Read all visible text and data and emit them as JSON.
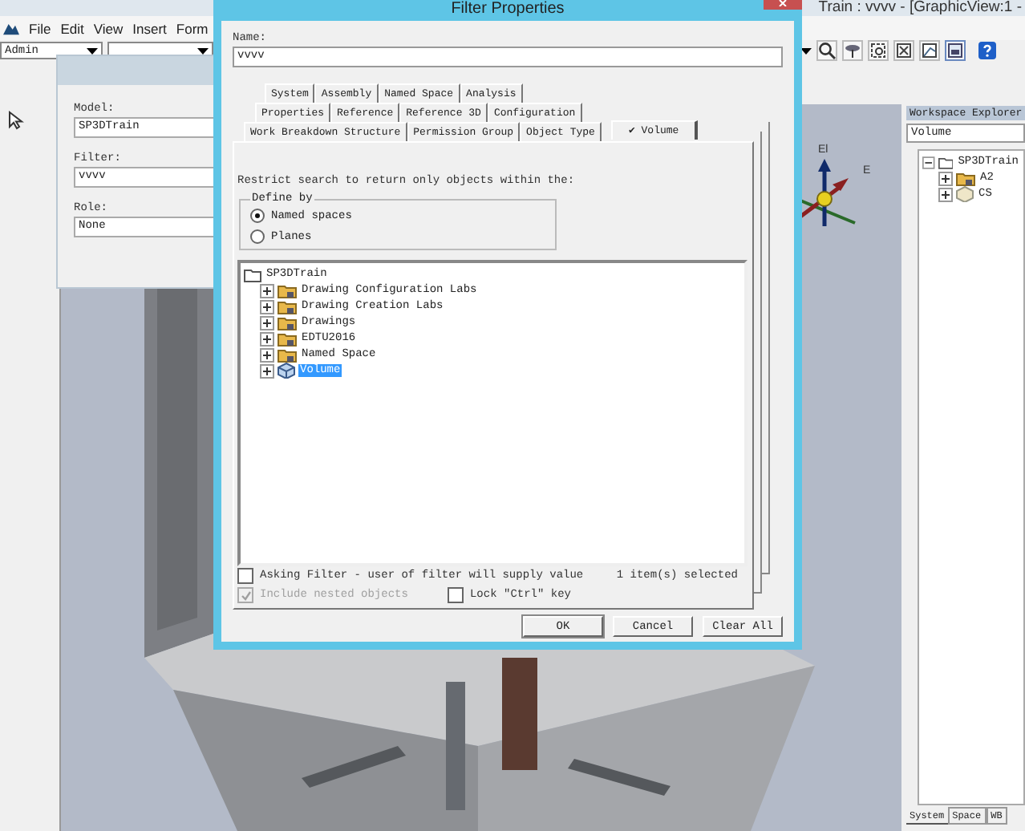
{
  "app": {
    "title": "Train : vvvv - [GraphicView:1 -",
    "menu": [
      "File",
      "Edit",
      "View",
      "Insert",
      "Form"
    ],
    "role_combo": {
      "value": "Admin"
    }
  },
  "viewport": {
    "axis_labels": [
      "El",
      "E"
    ]
  },
  "workspace_explorer": {
    "title": "Workspace Explorer",
    "filter": {
      "value": "Volume"
    },
    "tree": [
      {
        "label": "SP3DTrain",
        "kind": "root",
        "expanded": true,
        "children": [
          {
            "label": "A2",
            "kind": "folder",
            "expanded": false
          },
          {
            "label": "CS",
            "kind": "space",
            "expanded": false
          }
        ]
      }
    ],
    "tabs": [
      {
        "label": "System",
        "selected": true
      },
      {
        "label": "Space",
        "selected": false
      },
      {
        "label": "WB",
        "selected": false
      }
    ]
  },
  "select_dialog": {
    "fields": [
      {
        "label": "Model:",
        "value": "SP3DTrain"
      },
      {
        "label": "Filter:",
        "value": "vvvv"
      },
      {
        "label": "Role:",
        "value": "None"
      }
    ]
  },
  "filter_dialog": {
    "title": "Filter Properties",
    "name": {
      "label": "Name:",
      "value": "vvvv"
    },
    "tab_rows": [
      [
        {
          "label": "System",
          "selected": false
        },
        {
          "label": "Assembly",
          "selected": false
        },
        {
          "label": "Named Space",
          "selected": false
        },
        {
          "label": "Analysis",
          "selected": false
        }
      ],
      [
        {
          "label": "Properties",
          "selected": false
        },
        {
          "label": "Reference",
          "selected": false
        },
        {
          "label": "Reference 3D",
          "selected": false
        },
        {
          "label": "Configuration",
          "selected": false
        }
      ],
      [
        {
          "label": "Work Breakdown Structure",
          "selected": false
        },
        {
          "label": "Permission Group",
          "selected": false
        },
        {
          "label": "Object Type",
          "selected": false
        },
        {
          "label": "✔ Volume",
          "selected": true
        }
      ]
    ],
    "instruction": "Restrict search to return only objects within the:",
    "define_by": {
      "title": "Define by",
      "options": [
        {
          "label": "Named spaces",
          "selected": true
        },
        {
          "label": "Planes",
          "selected": false
        }
      ]
    },
    "tree": [
      {
        "label": "SP3DTrain",
        "kind": "root",
        "expanded": true,
        "selected": false,
        "children": [
          {
            "label": "Drawing Configuration Labs",
            "kind": "folder",
            "expanded": false,
            "selected": false
          },
          {
            "label": "Drawing Creation Labs",
            "kind": "folder",
            "expanded": false,
            "selected": false
          },
          {
            "label": "Drawings",
            "kind": "folder",
            "expanded": false,
            "selected": false
          },
          {
            "label": "EDTU2016",
            "kind": "folder",
            "expanded": false,
            "selected": false
          },
          {
            "label": "Named Space",
            "kind": "folder",
            "expanded": false,
            "selected": false
          },
          {
            "label": "Volume",
            "kind": "volume",
            "expanded": false,
            "selected": true
          }
        ]
      }
    ],
    "asking_filter": {
      "label": "Asking Filter - user of filter will supply value",
      "checked": false
    },
    "selection_count": "1 item(s) selected",
    "include_nested": {
      "label": "Include nested objects",
      "checked": true,
      "disabled": true
    },
    "lock_ctrl": {
      "label": "Lock \"Ctrl\" key",
      "checked": false
    },
    "buttons": [
      "OK",
      "Cancel",
      "Clear All"
    ]
  }
}
